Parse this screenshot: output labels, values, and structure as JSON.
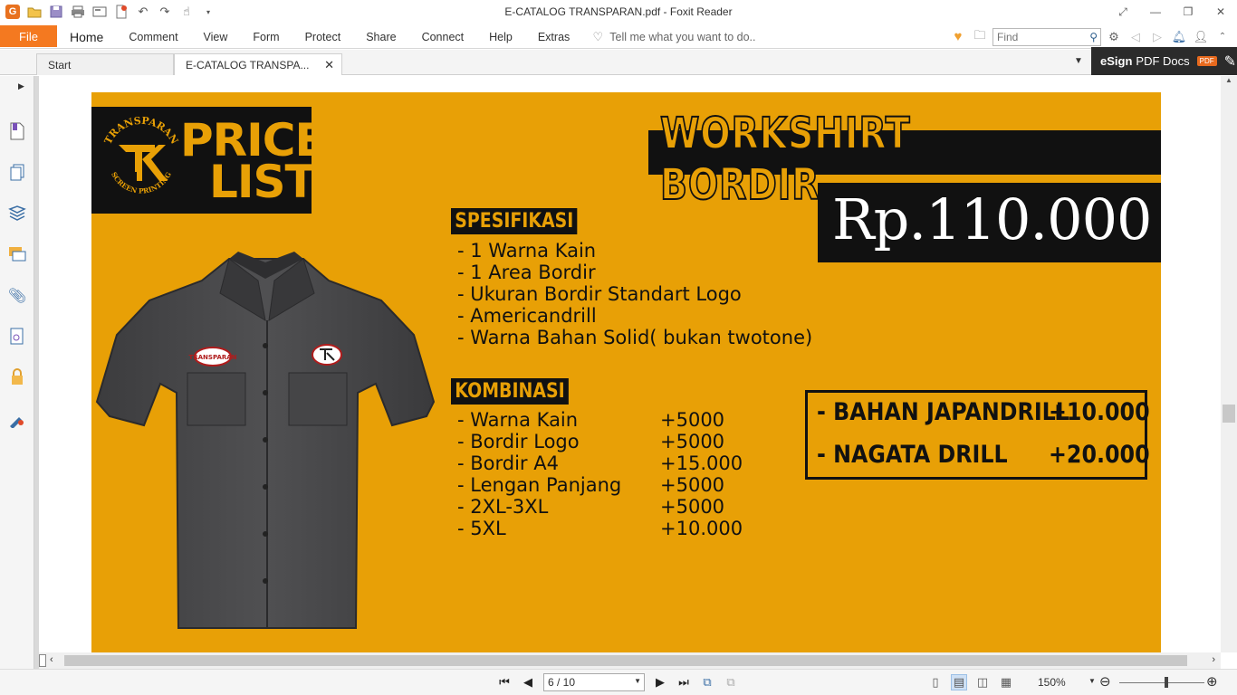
{
  "window": {
    "title": "E-CATALOG TRANSPARAN.pdf - Foxit Reader"
  },
  "menu": {
    "file": "File",
    "items": [
      "Home",
      "Comment",
      "View",
      "Form",
      "Protect",
      "Share",
      "Connect",
      "Help",
      "Extras"
    ],
    "tell_me": "Tell me what you want to do.."
  },
  "search": {
    "placeholder": "Find"
  },
  "tabs": [
    {
      "label": "Start"
    },
    {
      "label": "E-CATALOG TRANSPA..."
    }
  ],
  "esign": {
    "label_bold": "eSign",
    "label_rest": "PDF Docs",
    "badge": "PDF"
  },
  "document": {
    "logo_text_top": "TRANSPARAN",
    "logo_text_bottom": "SCREEN PRINTING",
    "price_list_line1": "PRICE",
    "price_list_line2": "LIST",
    "product_title": "WORKSHIRT BORDIR",
    "price": "Rp.110.000",
    "spec_title": "SPESIFIKASI",
    "spec_items": [
      "- 1 Warna Kain",
      "- 1 Area Bordir",
      "- Ukuran Bordir Standart Logo",
      "- Americandrill",
      "- Warna Bahan Solid( bukan twotone)"
    ],
    "combo_title": "KOMBINASI",
    "combo_items": [
      {
        "label": "- Warna Kain",
        "value": "+5000"
      },
      {
        "label": "- Bordir Logo",
        "value": "+5000"
      },
      {
        "label": "- Bordir A4",
        "value": "+15.000"
      },
      {
        "label": "- Lengan Panjang",
        "value": "+5000"
      },
      {
        "label": "- 2XL-3XL",
        "value": "+5000"
      },
      {
        "label": "- 5XL",
        "value": "+10.000"
      }
    ],
    "addons": [
      {
        "label": "- BAHAN JAPANDRILL",
        "value": "+10.000"
      },
      {
        "label": "- NAGATA DRILL",
        "value": "+20.000"
      }
    ],
    "shirt_patch_text": "TRANSPARAN"
  },
  "status": {
    "page": "6 / 10",
    "zoom": "150%"
  },
  "colors": {
    "accent": "#f47920",
    "page_bg": "#e8a006",
    "dark": "#111111"
  }
}
